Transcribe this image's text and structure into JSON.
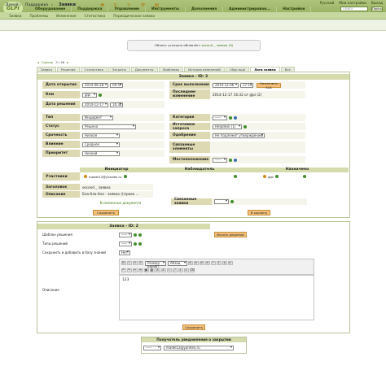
{
  "app": {
    "logo": "GLPI"
  },
  "top_links": [
    "Русский",
    "Мои настройки",
    "Выход"
  ],
  "search": {
    "placeholder": "Поиск",
    "go_label": "Поиск"
  },
  "main_nav": [
    "Оборудование",
    "Поддержка",
    "Управление",
    "Инструменты",
    "Дополнения",
    "Администрирован...",
    "Настройки"
  ],
  "sub_nav": [
    "Заявки",
    "Проблемы",
    "Изменения",
    "Статистика",
    "Периодические заявки"
  ],
  "breadcrumb": [
    "Домой",
    "Поддержка",
    "Заявки"
  ],
  "message": {
    "prefix": "Объект успешно обновлён:",
    "link": "second _ заявка (8)"
  },
  "nav_row": [
    "Список",
    "3 / 48"
  ],
  "tabs": [
    "Заявка",
    "Решение",
    "Статистика",
    "Затраты",
    "Документы",
    "Проблемы",
    "История изменений",
    "Сбор ещё",
    "Логи заявки",
    "Все"
  ],
  "ticket": {
    "header": "Заявка - ID: 2",
    "opened_label": "Дата открытия",
    "opened_date": "2014-08-28",
    "opened_time": "09:57",
    "by_label": "Кем",
    "by_value": "glpi",
    "resolved_label": "Дата решения",
    "resolved_date": "2014-12-17",
    "resolved_time": "16:32",
    "due_label": "Срок выполнения",
    "due_date": "2014-12-06",
    "due_time": "17:11",
    "sla_button": "Назначить SLA",
    "last_update_label": "Последнее изменение",
    "last_update_value": "2014-12-17 16:32 от glpi (2)",
    "type_label": "Тип",
    "type_value": "Инцидент",
    "status_label": "Статус",
    "status_value": "Решена",
    "urgency_label": "Срочность",
    "urgency_value": "Низкая",
    "impact_label": "Влияние",
    "impact_value": "Среднее",
    "priority_label": "Приоритет",
    "priority_value": "Низкий",
    "category_label": "Категория",
    "category_value": "-----",
    "source_label": "Источники запроса",
    "source_value": "Helpdesk (1)",
    "approval_label": "Одобрение",
    "approval_value": "Не подлежит утверждению",
    "linked_label": "Связанные элементы",
    "location_label": "Местоположение",
    "location_value": "-----",
    "actor_header": "Участники",
    "requester_header": "Инициатор",
    "observer_header": "Наблюдатель",
    "assigned_header": "Назначено",
    "requester_value": "madel12@yandex.ru",
    "assigned_value": "glpi",
    "title_label": "Заголовок",
    "title_value": "second _ заявка",
    "desc_label": "Описание",
    "desc_value": "Бла-бла-бла - заявка Ⓐпроек ...",
    "linked_tickets_label": "Связанные заявки",
    "linked_docs_label": "N связанных документа",
    "save_button": "Сохранить",
    "trash_button": "В корзину"
  },
  "solution": {
    "header": "Заявка - ID: 2",
    "template_label": "Шаблон решения",
    "template_value": "-----",
    "type_label": "Типы решений",
    "type_value": "-----",
    "kb_label": "Сохранить и добавить в базу знаний",
    "kb_value": "Нет",
    "search_button": "Искать решение",
    "desc_label": "Описание",
    "editor_format": "Размер шрифт",
    "editor_style": "Абзац",
    "editor_text": "123",
    "save_button": "Сохранить"
  },
  "notify": {
    "header": "Получатель уведомления о закрытии",
    "select_value": "-----",
    "email_value": "madel12@yandex.ru"
  }
}
